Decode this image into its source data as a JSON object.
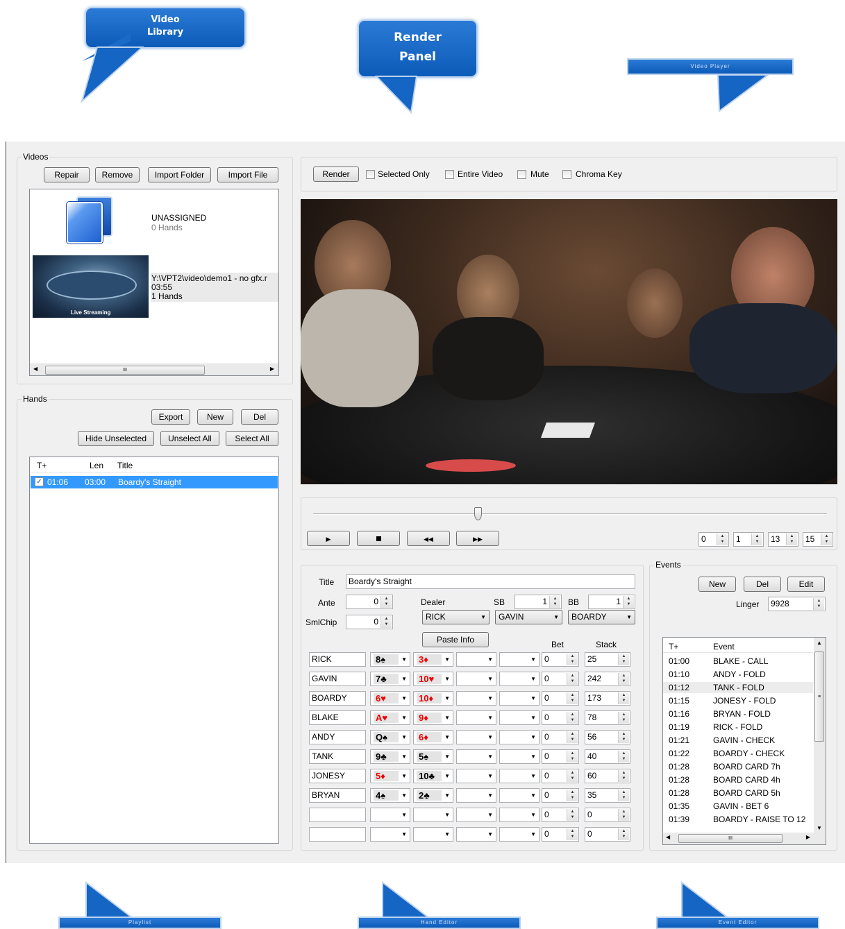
{
  "callouts": {
    "video_library": "Video Library",
    "render_panel_1": "Render",
    "render_panel_2": "Panel",
    "video_player": "Video Player",
    "playlist": "Playlist",
    "hand_editor": "Hand Editor",
    "event_editor": "Event Editor"
  },
  "videos": {
    "group_label": "Videos",
    "buttons": {
      "repair": "Repair",
      "remove": "Remove",
      "import_folder": "Import Folder",
      "import_file": "Import File"
    },
    "items": [
      {
        "title": "UNASSIGNED",
        "subtitle": "0 Hands"
      },
      {
        "path": "Y:\\VPT2\\video\\demo1 - no gfx.r",
        "duration": "03:55",
        "hands": "1 Hands",
        "thumb_caption": "Live Streaming"
      }
    ],
    "scroll_grip": "III"
  },
  "hands": {
    "group_label": "Hands",
    "buttons": {
      "export": "Export",
      "new": "New",
      "del": "Del",
      "hide_unselected": "Hide Unselected",
      "unselect_all": "Unselect All",
      "select_all": "Select All"
    },
    "columns": {
      "t": "T+",
      "len": "Len",
      "title": "Title"
    },
    "rows": [
      {
        "checked": true,
        "t": "01:06",
        "len": "03:00",
        "title": "Boardy's Straight"
      }
    ]
  },
  "render": {
    "button": "Render",
    "options": [
      {
        "label": "Selected Only",
        "checked": false
      },
      {
        "label": "Entire Video",
        "checked": false
      },
      {
        "label": "Mute",
        "checked": false
      },
      {
        "label": "Chroma Key",
        "checked": false
      }
    ]
  },
  "player": {
    "position": 0.32,
    "controls": {
      "play": "play-icon",
      "stop": "stop-icon",
      "rewind": "rewind-icon",
      "forward": "fast-forward-icon"
    },
    "timecode": [
      "0",
      "1",
      "13",
      "15"
    ]
  },
  "hand_editor": {
    "title_label": "Title",
    "title_value": "Boardy's Straight",
    "ante_label": "Ante",
    "ante_value": "0",
    "smlchip_label": "SmlChip",
    "smlchip_value": "0",
    "dealer_label": "Dealer",
    "dealer_value": "RICK",
    "sb_label": "SB",
    "sb_value": "1",
    "sb_player": "GAVIN",
    "bb_label": "BB",
    "bb_value": "1",
    "bb_player": "BOARDY",
    "paste_info": "Paste Info",
    "bet_label": "Bet",
    "stack_label": "Stack",
    "players": [
      {
        "name": "RICK",
        "c1": "8♠",
        "c1red": false,
        "c2": "3♦",
        "c2red": true,
        "bet": "0",
        "stack": "25"
      },
      {
        "name": "GAVIN",
        "c1": "7♣",
        "c1red": false,
        "c2": "10♥",
        "c2red": true,
        "bet": "0",
        "stack": "242"
      },
      {
        "name": "BOARDY",
        "c1": "6♥",
        "c1red": true,
        "c2": "10♦",
        "c2red": true,
        "bet": "0",
        "stack": "173"
      },
      {
        "name": "BLAKE",
        "c1": "A♥",
        "c1red": true,
        "c2": "9♦",
        "c2red": true,
        "bet": "0",
        "stack": "78"
      },
      {
        "name": "ANDY",
        "c1": "Q♠",
        "c1red": false,
        "c2": "6♦",
        "c2red": true,
        "bet": "0",
        "stack": "56"
      },
      {
        "name": "TANK",
        "c1": "9♣",
        "c1red": false,
        "c2": "5♠",
        "c2red": false,
        "bet": "0",
        "stack": "40"
      },
      {
        "name": "JONESY",
        "c1": "5♦",
        "c1red": true,
        "c2": "10♣",
        "c2red": false,
        "bet": "0",
        "stack": "60"
      },
      {
        "name": "BRYAN",
        "c1": "4♠",
        "c1red": false,
        "c2": "2♣",
        "c2red": false,
        "bet": "0",
        "stack": "35"
      },
      {
        "name": "",
        "c1": "",
        "c1red": false,
        "c2": "",
        "c2red": false,
        "bet": "0",
        "stack": "0"
      },
      {
        "name": "",
        "c1": "",
        "c1red": false,
        "c2": "",
        "c2red": false,
        "bet": "0",
        "stack": "0"
      }
    ]
  },
  "events": {
    "group_label": "Events",
    "buttons": {
      "new": "New",
      "del": "Del",
      "edit": "Edit"
    },
    "linger_label": "Linger",
    "linger_value": "9928",
    "columns": {
      "t": "T+",
      "event": "Event"
    },
    "rows": [
      {
        "t": "01:00",
        "event": "BLAKE - CALL"
      },
      {
        "t": "01:10",
        "event": "ANDY - FOLD"
      },
      {
        "t": "01:12",
        "event": "TANK - FOLD"
      },
      {
        "t": "01:15",
        "event": "JONESY - FOLD"
      },
      {
        "t": "01:16",
        "event": "BRYAN - FOLD"
      },
      {
        "t": "01:19",
        "event": "RICK - FOLD"
      },
      {
        "t": "01:21",
        "event": "GAVIN - CHECK"
      },
      {
        "t": "01:22",
        "event": "BOARDY - CHECK"
      },
      {
        "t": "01:28",
        "event": "BOARD CARD 7h"
      },
      {
        "t": "01:28",
        "event": "BOARD CARD 4h"
      },
      {
        "t": "01:28",
        "event": "BOARD CARD 5h"
      },
      {
        "t": "01:35",
        "event": "GAVIN - BET 6"
      },
      {
        "t": "01:39",
        "event": "BOARDY - RAISE TO 12"
      }
    ],
    "scroll_grip": "III"
  }
}
